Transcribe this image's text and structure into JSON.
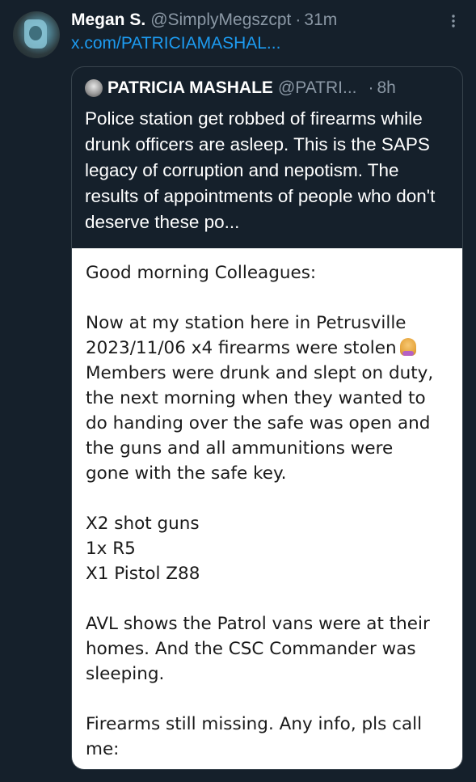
{
  "tweet": {
    "display_name": "Megan S.",
    "handle": "@SimplyMegszcpt",
    "separator": "·",
    "time": "31m",
    "link_text": "x.com/PATRICIAMASHAL..."
  },
  "quote": {
    "display_name": "PATRICIA MASHALE",
    "handle": "@PATRI...",
    "separator": "·",
    "time": "8h",
    "text": "Police station get robbed of firearms while drunk officers are asleep. This is the SAPS legacy of corruption and nepotism. The results of appointments of people who don't deserve these po..."
  },
  "image_text": {
    "line1": "Good morning Colleagues:",
    "line2": "Now at my station here in Petrusville",
    "line3": "2023/11/06 x4 firearms were stolen",
    "line4": "Members were drunk and slept on duty,",
    "line5": "the next morning when they wanted to",
    "line6": "do handing over the safe was open and",
    "line7": "the guns and all ammunitions were",
    "line8": "gone with the safe key.",
    "line9": "X2 shot guns",
    "line10": "1x R5",
    "line11": "X1 Pistol Z88",
    "line12": "AVL shows the Patrol vans were at their",
    "line13": "homes. And the CSC Commander was",
    "line14": "sleeping.",
    "line15": "Firearms still missing. Any info, pls call",
    "line16": "me:"
  },
  "icons": {
    "more": "more-vertical-icon",
    "emoji": "facepalm-woman-emoji"
  },
  "colors": {
    "background": "#15202b",
    "accent_link": "#1d9bf0",
    "muted_text": "#8b98a5",
    "border": "#38444d"
  }
}
